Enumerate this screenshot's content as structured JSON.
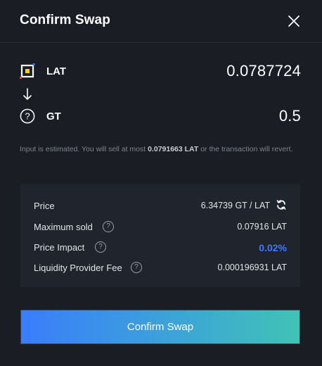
{
  "header": {
    "title": "Confirm Swap"
  },
  "from_token": {
    "symbol": "LAT",
    "amount": "0.0787724"
  },
  "to_token": {
    "symbol": "GT",
    "amount": "0.5"
  },
  "note": {
    "prefix": "Input is estimated. You will sell at most ",
    "max_amount": "0.0791663 LAT",
    "suffix": " or the transaction will revert."
  },
  "details": {
    "price_label": "Price",
    "price_value": "6.34739 GT / LAT",
    "max_sold_label": "Maximum sold",
    "max_sold_value": "0.07916 LAT",
    "impact_label": "Price Impact",
    "impact_value": "0.02%",
    "fee_label": "Liquidity Provider Fee",
    "fee_value": "0.000196931 LAT",
    "help_glyph": "?"
  },
  "confirm_button": {
    "label": "Confirm Swap"
  },
  "colors": {
    "background": "#1a1d24",
    "panel": "#20242c",
    "impact": "#3a7bff",
    "button_gradient_start": "#3a7dfb",
    "button_gradient_end": "#40c3b5"
  },
  "icons": {
    "close": "close-icon",
    "from_token": "lat-token-icon",
    "to_token": "unknown-token-icon",
    "arrow": "arrow-down-icon",
    "help": "help-icon",
    "refresh": "refresh-icon"
  }
}
